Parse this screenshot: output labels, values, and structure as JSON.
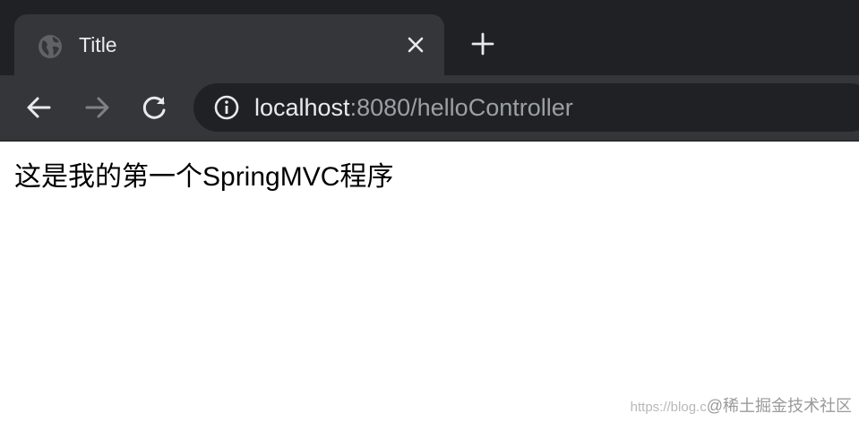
{
  "tab": {
    "title": "Title",
    "favicon": "globe-icon",
    "close_icon": "close-icon",
    "new_tab_icon": "plus-icon"
  },
  "toolbar": {
    "back_icon": "arrow-left-icon",
    "forward_icon": "arrow-right-icon",
    "reload_icon": "reload-icon",
    "site_info_icon": "info-icon",
    "forward_enabled": false
  },
  "address_bar": {
    "host": "localhost",
    "rest": ":8080/helloController"
  },
  "page": {
    "text": "这是我的第一个SpringMVC程序"
  },
  "watermark": {
    "url_part": "https://blog.c",
    "brand": "@稀土掘金技术社区"
  },
  "colors": {
    "tabstrip_bg": "#202124",
    "tab_active_bg": "#35363a",
    "omnibox_bg": "#202124",
    "text_primary": "#e8eaed",
    "text_secondary": "#9aa0a6"
  }
}
